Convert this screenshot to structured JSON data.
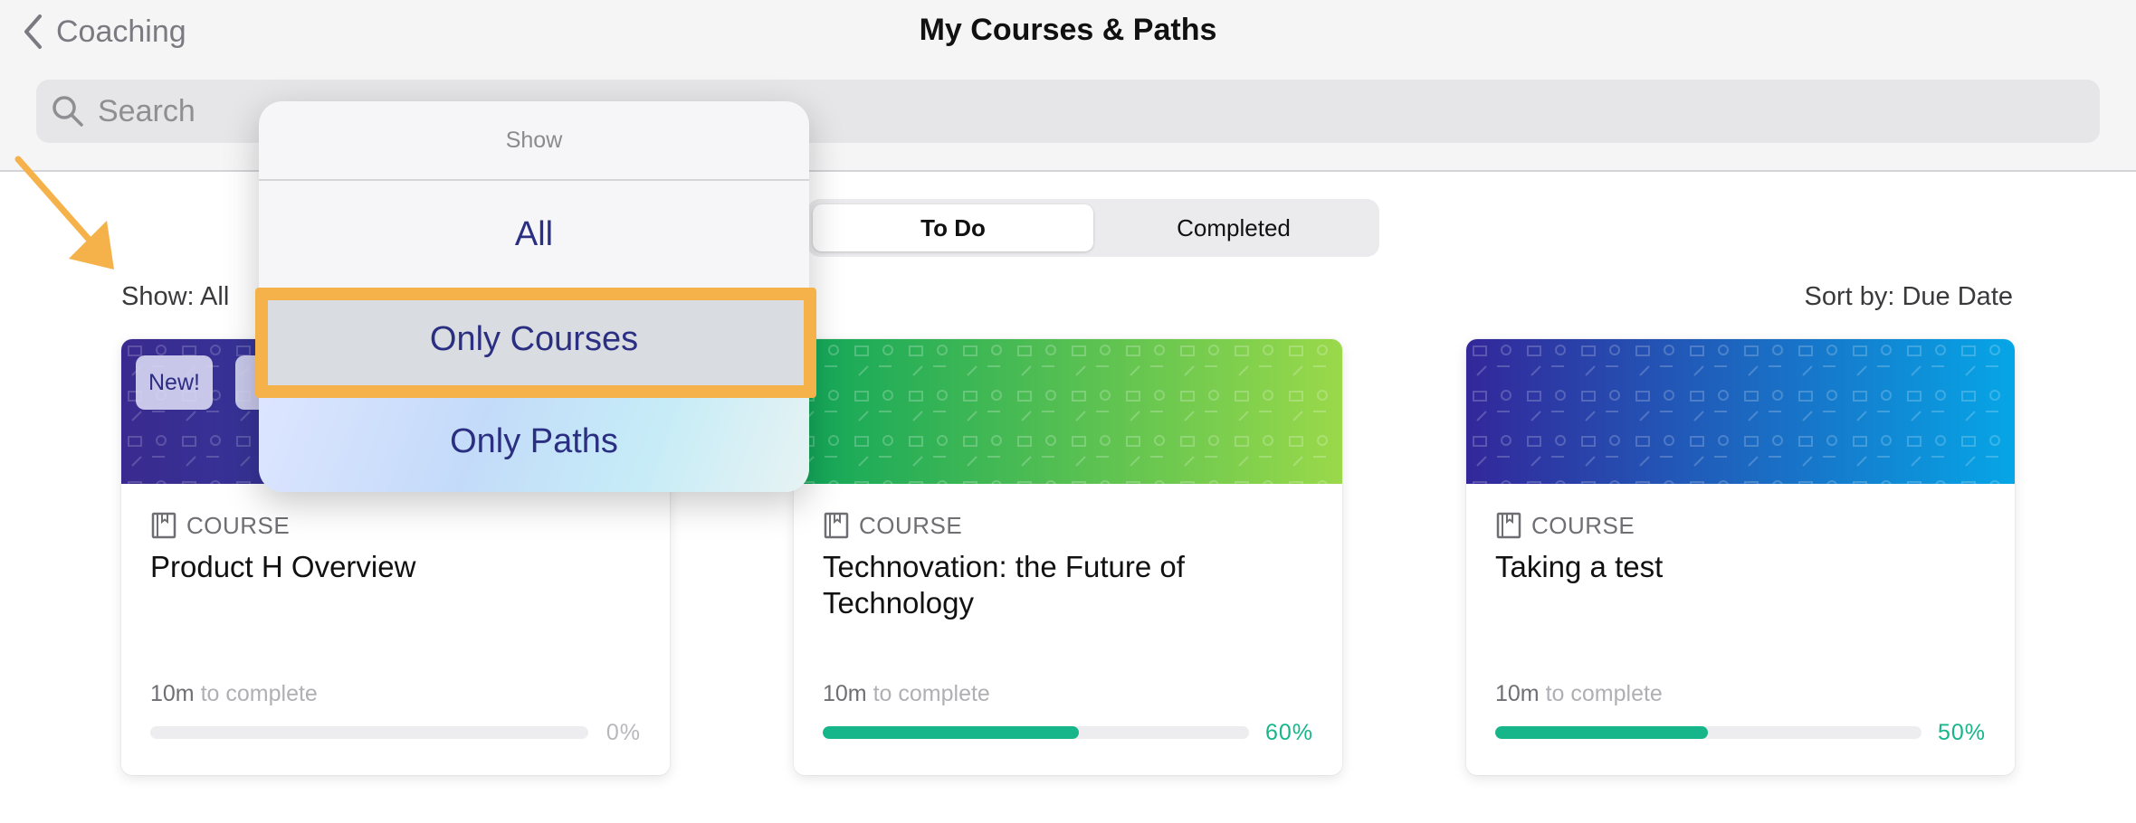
{
  "header": {
    "back_label": "Coaching",
    "title": "My Courses & Paths",
    "search_placeholder": "Search"
  },
  "tabs": [
    {
      "label": "To Do",
      "active": true
    },
    {
      "label": "Completed",
      "active": false
    }
  ],
  "filters": {
    "show_label": "Show: All",
    "sort_label": "Sort by: Due Date"
  },
  "popover": {
    "header": "Show",
    "items": [
      {
        "label": "All",
        "highlighted": false
      },
      {
        "label": "Only Courses",
        "highlighted": true
      },
      {
        "label": "Only Paths",
        "highlighted": false
      }
    ]
  },
  "cards": [
    {
      "badge": "New!",
      "type": "COURSE",
      "title": "Product H Overview",
      "duration_value": "10m",
      "duration_suffix": "to complete",
      "progress": 0,
      "progress_label": "0%",
      "banner_colors": [
        "#3a2a8f",
        "#2a4fb0"
      ]
    },
    {
      "type": "COURSE",
      "title": "Technovation: the Future of Technology",
      "duration_value": "10m",
      "duration_suffix": "to complete",
      "progress": 60,
      "progress_label": "60%",
      "banner_colors": [
        "#10a65a",
        "#9ad94a"
      ]
    },
    {
      "type": "COURSE",
      "title": "Taking a test",
      "duration_value": "10m",
      "duration_suffix": "to complete",
      "progress": 50,
      "progress_label": "50%",
      "banner_colors": [
        "#33279a",
        "#06a6e6"
      ]
    }
  ],
  "colors": {
    "accent_progress": "#17b58a",
    "highlight": "#f5b24a",
    "menu_text": "#2b2f82"
  }
}
